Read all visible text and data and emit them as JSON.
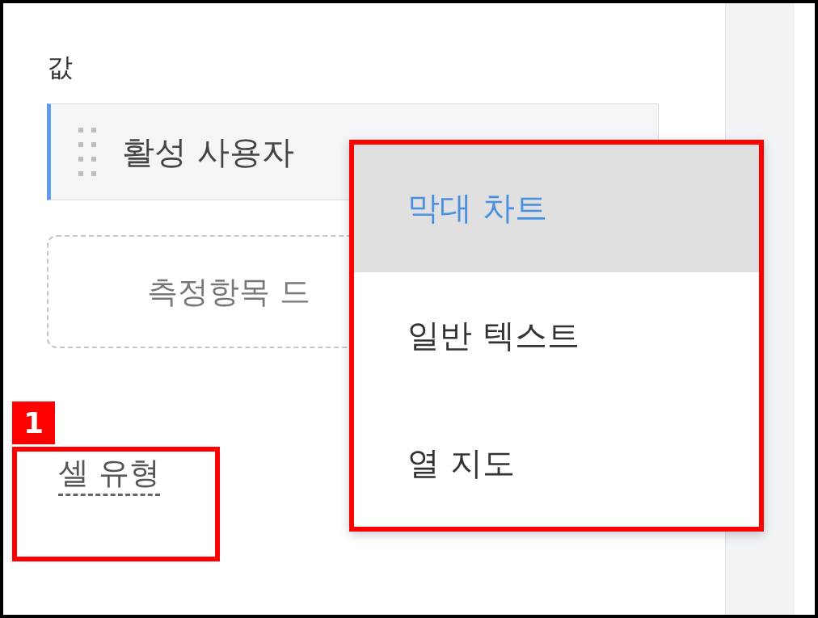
{
  "section_label": "값",
  "value_chip": {
    "label": "활성 사용자"
  },
  "drop_zone": {
    "text": "측정항목 드"
  },
  "cell_type": {
    "label": "셀 유형"
  },
  "annotation": {
    "number": "1"
  },
  "dropdown_menu": {
    "items": [
      {
        "label": "막대 차트",
        "selected": true
      },
      {
        "label": "일반 텍스트",
        "selected": false
      },
      {
        "label": "열 지도",
        "selected": false
      }
    ]
  }
}
